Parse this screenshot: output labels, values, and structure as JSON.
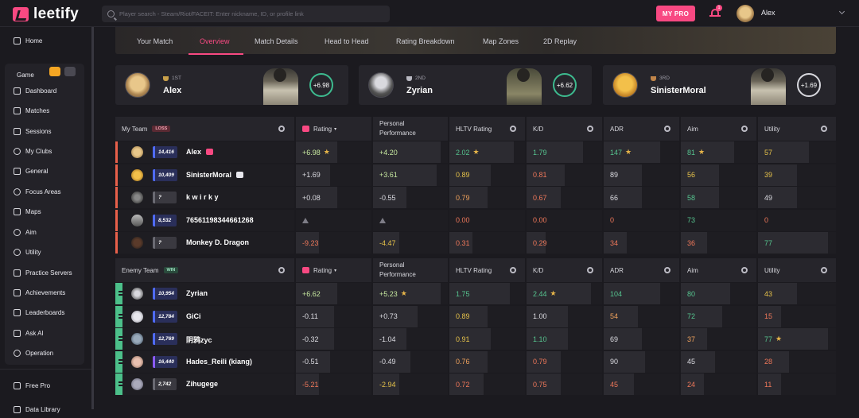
{
  "app": {
    "logo_text": "leetify"
  },
  "search": {
    "placeholder": "Player search - Steam/Riot/FACEIT: Enter nickname, ID, or profile link"
  },
  "header": {
    "mypro_label": "MY PRO",
    "notification_count": "1",
    "user_name": "Alex"
  },
  "sidebar": {
    "home": "Home",
    "game_label": "Game",
    "items": [
      "Dashboard",
      "Matches",
      "Sessions",
      "My Clubs",
      "General",
      "Focus Areas",
      "Maps",
      "Aim",
      "Utility",
      "Practice Servers",
      "Achievements",
      "Leaderboards",
      "Ask AI",
      "Operation"
    ],
    "free_pro": "Free Pro",
    "data_library": "Data Library"
  },
  "tabs": [
    "Your Match",
    "Overview",
    "Match Details",
    "Head to Head",
    "Rating Breakdown",
    "Map Zones",
    "2D Replay"
  ],
  "active_tab": "Overview",
  "podium": [
    {
      "place": "1ST",
      "name": "Alex",
      "rating": "+6.98"
    },
    {
      "place": "2ND",
      "name": "Zyrian",
      "rating": "+6.62"
    },
    {
      "place": "3RD",
      "name": "SinisterMoral",
      "rating": "+1.69"
    }
  ],
  "columns": {
    "rating": "Rating",
    "personal1": "Personal",
    "personal2": "Performance",
    "hltv": "HLTV Rating",
    "kd": "K/D",
    "adr": "ADR",
    "aim": "Aim",
    "utility": "Utility"
  },
  "my_team": {
    "label": "My Team",
    "result": "LOSS",
    "players": [
      {
        "elo": "14,416",
        "name": "Alex",
        "rating": "+6.98",
        "personal": "+4.20",
        "hltv": "2.02",
        "kd": "1.79",
        "adr": "147",
        "aim": "81",
        "utility": "57"
      },
      {
        "elo": "10,409",
        "name": "SinisterMoral",
        "rating": "+1.69",
        "personal": "+3.61",
        "hltv": "0.89",
        "kd": "0.81",
        "adr": "89",
        "aim": "56",
        "utility": "39"
      },
      {
        "elo": "?",
        "name": "k w i r k y",
        "rating": "+0.08",
        "personal": "-0.55",
        "hltv": "0.79",
        "kd": "0.67",
        "adr": "66",
        "aim": "58",
        "utility": "49"
      },
      {
        "elo": "8,532",
        "name": "76561198344661268",
        "rating": "",
        "personal": "",
        "hltv": "0.00",
        "kd": "0.00",
        "adr": "0",
        "aim": "73",
        "utility": "0"
      },
      {
        "elo": "?",
        "name": "Monkey D. Dragon",
        "rating": "-9.23",
        "personal": "-4.47",
        "hltv": "0.31",
        "kd": "0.29",
        "adr": "34",
        "aim": "36",
        "utility": "77"
      }
    ]
  },
  "enemy_team": {
    "label": "Enemy Team",
    "result": "WIN",
    "players": [
      {
        "elo": "10,954",
        "name": "Zyrian",
        "rating": "+6.62",
        "personal": "+5.23",
        "hltv": "1.75",
        "kd": "2.44",
        "adr": "104",
        "aim": "80",
        "utility": "43"
      },
      {
        "elo": "12,784",
        "name": "GiCi",
        "rating": "-0.11",
        "personal": "+0.73",
        "hltv": "0.89",
        "kd": "1.00",
        "adr": "54",
        "aim": "72",
        "utility": "15"
      },
      {
        "elo": "12,769",
        "name": "阴鸦zyc",
        "rating": "-0.32",
        "personal": "-1.04",
        "hltv": "0.91",
        "kd": "1.10",
        "adr": "69",
        "aim": "37",
        "utility": "77"
      },
      {
        "elo": "16,440",
        "name": "Hades_Reili (kiang)",
        "rating": "-0.51",
        "personal": "-0.49",
        "hltv": "0.76",
        "kd": "0.79",
        "adr": "90",
        "aim": "45",
        "utility": "28"
      },
      {
        "elo": "2,742",
        "name": "Zihugege",
        "rating": "-5.21",
        "personal": "-2.94",
        "hltv": "0.72",
        "kd": "0.75",
        "adr": "45",
        "aim": "24",
        "utility": "11"
      }
    ]
  }
}
